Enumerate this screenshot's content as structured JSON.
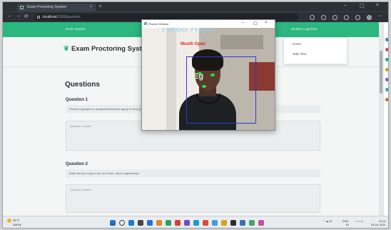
{
  "browser": {
    "tab_title": "Exam Proctoring System",
    "tab_close": "×",
    "new_tab": "+",
    "url_host": "localhost",
    "url_path": ":5000/question",
    "window_controls": [
      "–",
      "▢",
      "×"
    ],
    "nav_buttons": [
      "←",
      "→",
      "⟳"
    ]
  },
  "site": {
    "nav_items": [
      "Exam System",
      "Student Login/Out"
    ],
    "dropdown_items": [
      "Home",
      "Take Test"
    ],
    "brand_title": "Exam Proctoring System",
    "brand_icon": "leaf-icon"
  },
  "main": {
    "heading": "Questions",
    "questions": [
      {
        "label": "Question 1",
        "text": "Should copyright on assignments/exams apply to other people too? Explain your answer",
        "placeholder": "Question 1 answer"
      },
      {
        "label": "Question 2",
        "text": "What did you enjoy most, and least, about engineering?",
        "placeholder": "Question 2 answer"
      }
    ]
  },
  "cam_window": {
    "title": "Proctor Window",
    "controls": [
      "–",
      "▢",
      "×"
    ],
    "overlay_big": "Head Right",
    "overlay_red": "Mouth Open",
    "overlay_face": "Eg"
  },
  "taskbar": {
    "weather_temp": "31°C",
    "weather_desc": "Sunny",
    "tray_lang": "ENG",
    "tray_region": "IN",
    "time": "10:15",
    "date": "28-04-2022",
    "app_colors": [
      "#1e7bd6",
      "#444444",
      "#2a6fc9",
      "#e08a1d",
      "#2ca15e",
      "#d63c3c",
      "#6a4bcf",
      "#1e9bd6",
      "#e0483a",
      "#3aa0d6",
      "#d9a21b",
      "#2d2d2d",
      "#3a6fb5",
      "#48a36b",
      "#c94f9e"
    ]
  },
  "sidebar_icon_colors": [
    "#2f7fd6",
    "#d94848",
    "#2aa86a",
    "#c89a1e",
    "#7a55cf",
    "#2aa8b8",
    "#d66a2a"
  ]
}
